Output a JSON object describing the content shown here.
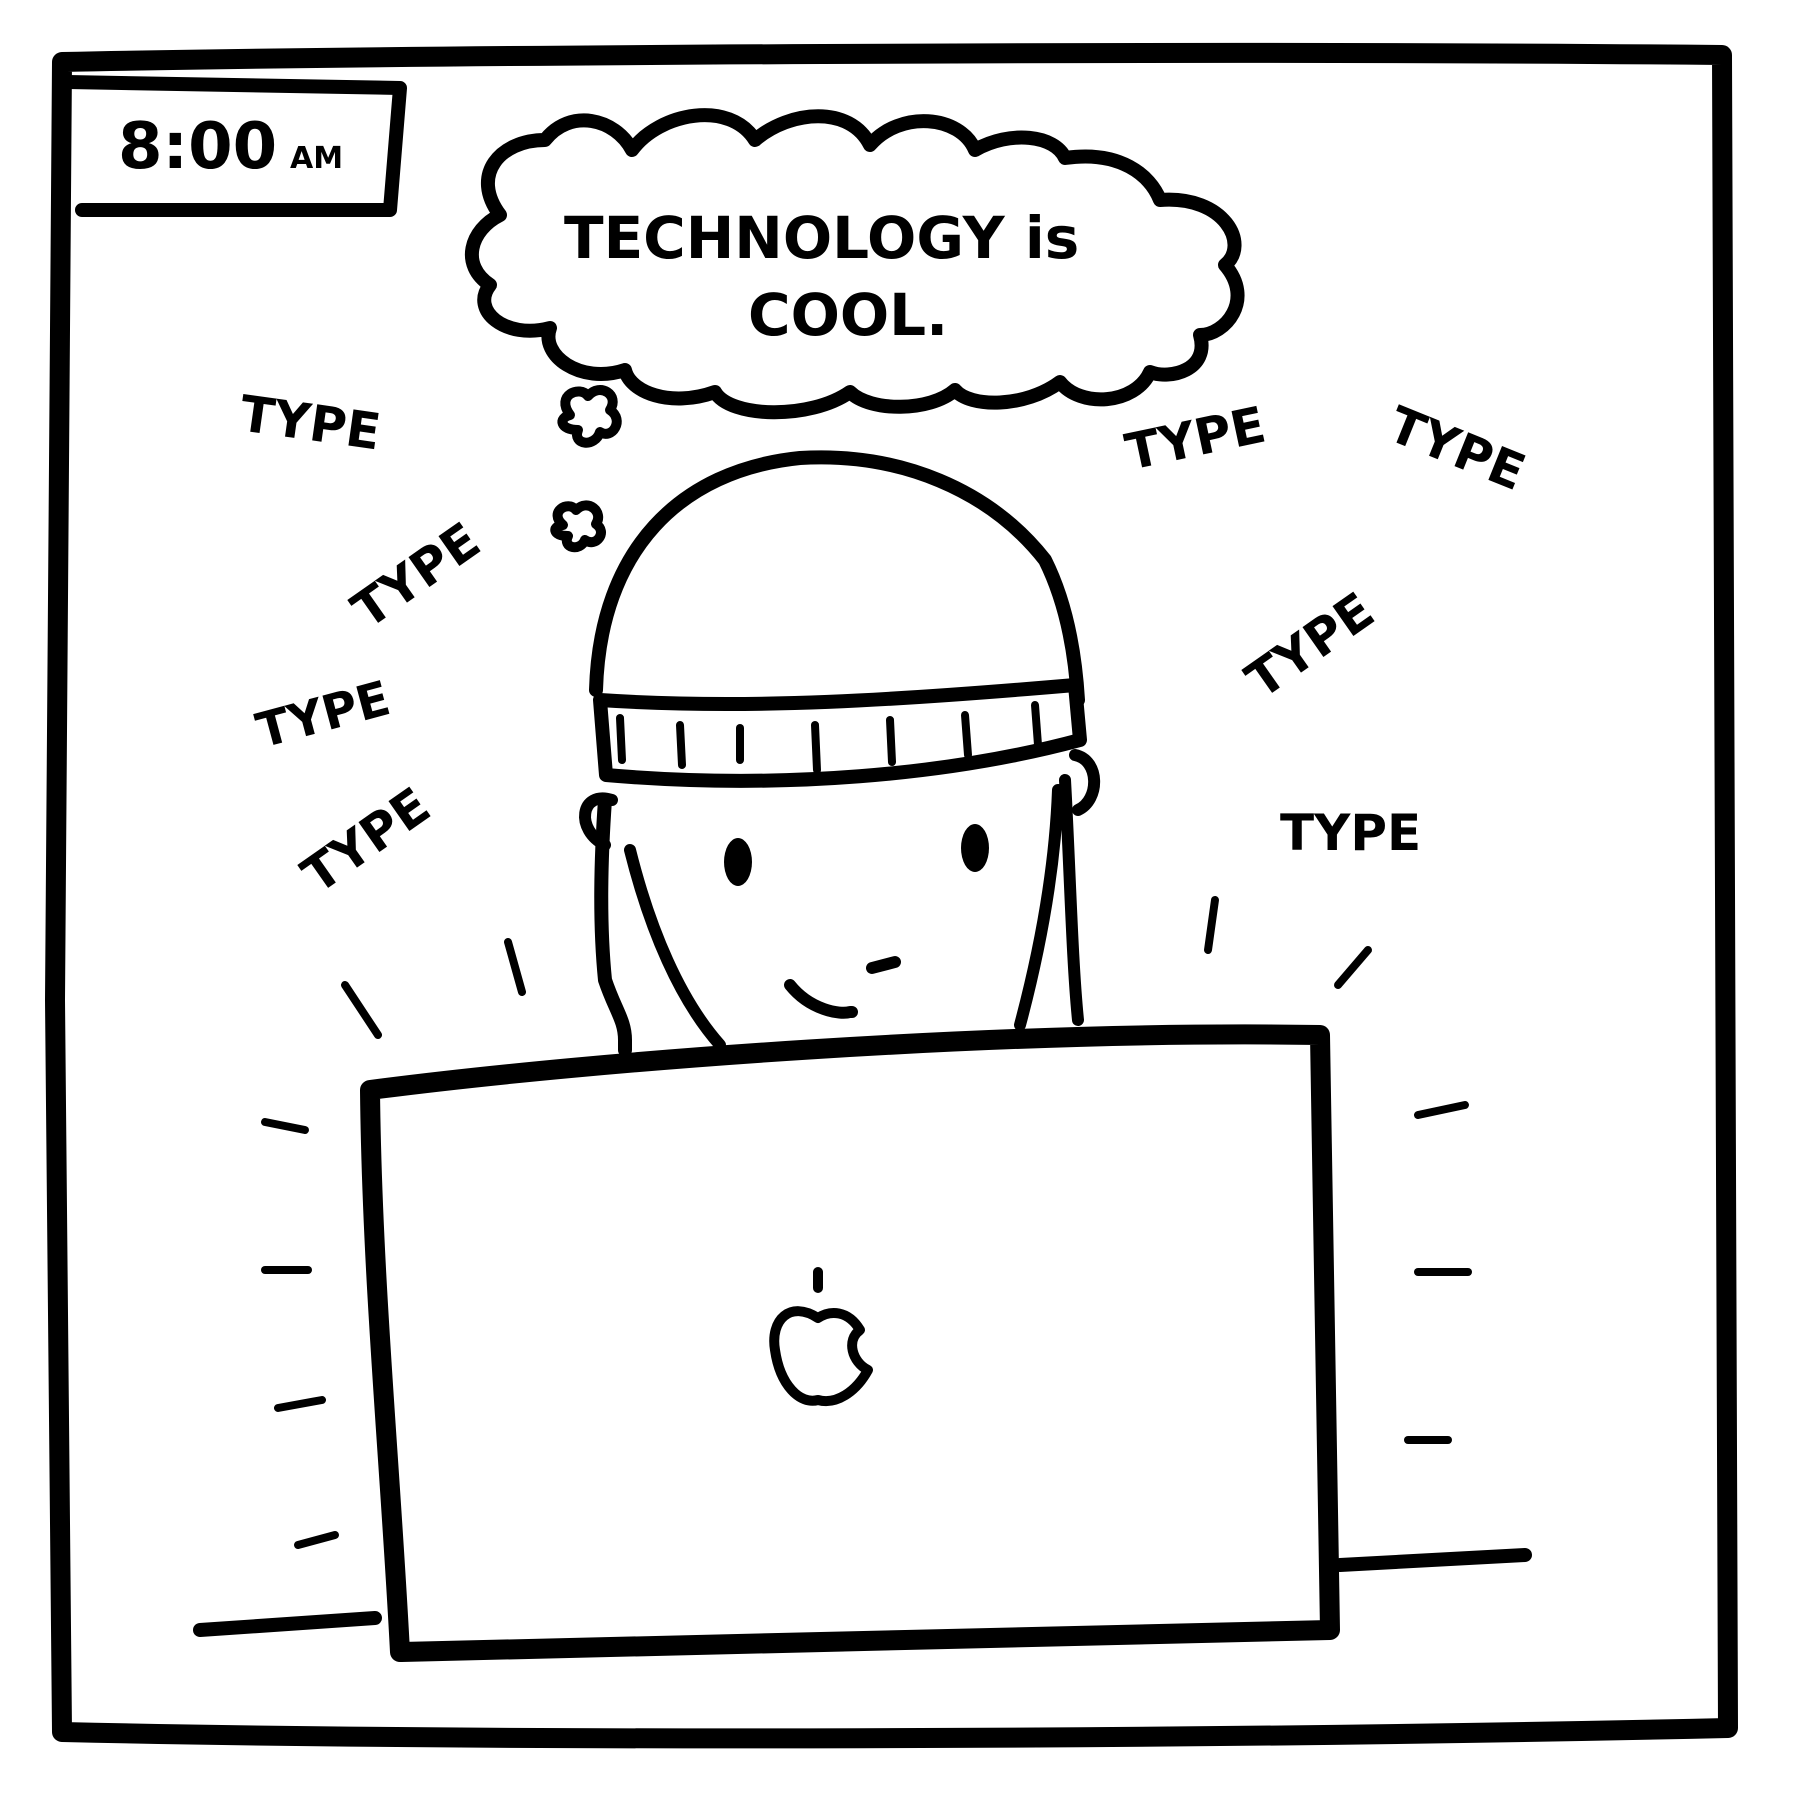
{
  "panel": {
    "timestamp": {
      "time": "8:00",
      "meridiem": "AM"
    },
    "thought_bubble": {
      "line1": "TECHNOLOGY is",
      "line2": "COOL."
    },
    "sound_effects": [
      "TYPE",
      "TYPE",
      "TYPE",
      "TYPE",
      "TYPE",
      "TYPE",
      "TYPE",
      "TYPE"
    ]
  },
  "colors": {
    "ink": "#000000",
    "paper": "#ffffff"
  },
  "icons": {
    "laptop_logo": "apple-logo-icon",
    "steam_puffs": "puff-icon"
  }
}
